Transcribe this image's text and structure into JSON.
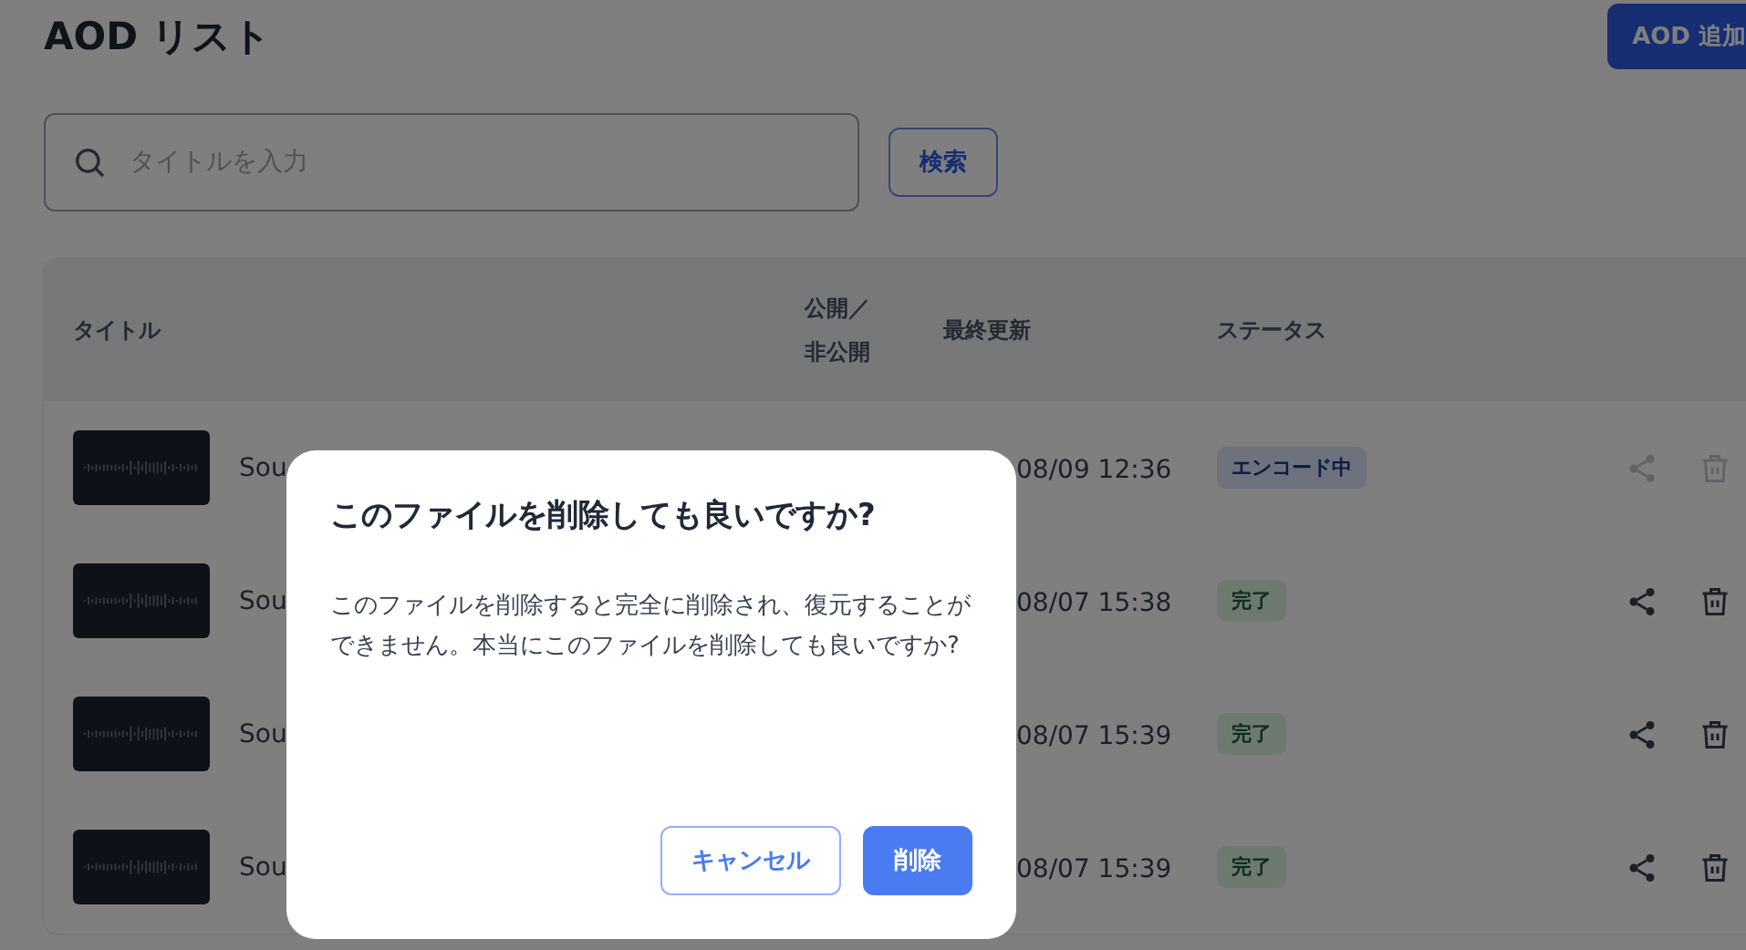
{
  "page": {
    "title": "AOD リスト",
    "add_button": "AOD 追加"
  },
  "search": {
    "placeholder": "タイトルを入力",
    "button": "検索"
  },
  "table": {
    "columns": [
      "タイトル",
      "公開／非公開",
      "最終更新",
      "ステータス"
    ],
    "rows": [
      {
        "title": "Sou",
        "updated": "08/09 12:36",
        "status": {
          "label": "エンコード中",
          "kind": "encoding"
        },
        "disabled": true
      },
      {
        "title": "Sou",
        "updated": "08/07 15:38",
        "status": {
          "label": "完了",
          "kind": "complete"
        },
        "disabled": false
      },
      {
        "title": "Sou",
        "updated": "08/07 15:39",
        "status": {
          "label": "完了",
          "kind": "complete"
        },
        "disabled": false
      },
      {
        "title": "Sou",
        "updated": "08/07 15:39",
        "status": {
          "label": "完了",
          "kind": "complete"
        },
        "disabled": false
      }
    ]
  },
  "dialog": {
    "title": "このファイルを削除しても良いですか?",
    "message": "このファイルを削除すると完全に削除され、復元することができません。本当にこのファイルを削除しても良いですか?",
    "buttons": [
      {
        "label": "キャンセル",
        "kind": "secondary"
      },
      {
        "label": "削除",
        "kind": "primary"
      }
    ]
  }
}
